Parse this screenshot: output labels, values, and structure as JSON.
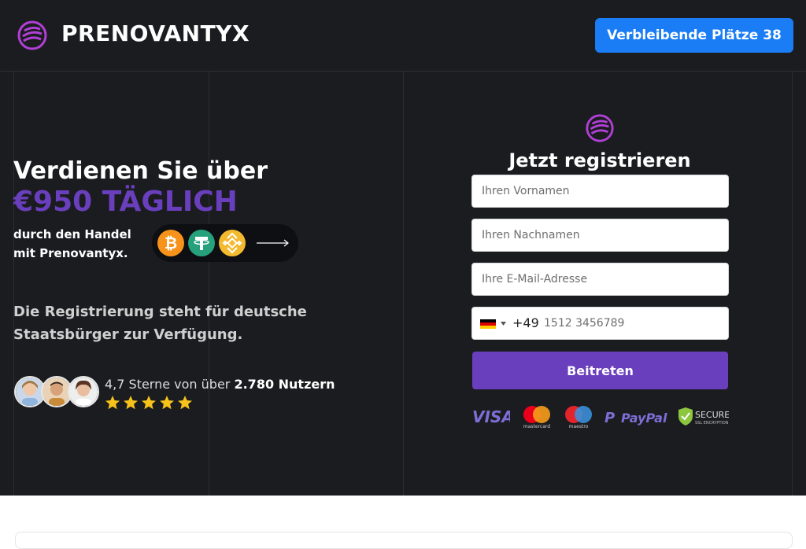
{
  "header": {
    "brand": "PRENOVANTYX",
    "cta_label": "Verbleibende Plätze 38"
  },
  "hero": {
    "headline": "Verdienen Sie über",
    "amount": "€950 TÄGLICH",
    "subtext": "durch den Handel mit Prenovantyx.",
    "coins": [
      "bitcoin-icon",
      "tether-icon",
      "binance-icon"
    ],
    "availability": "Die Registrierung steht für deutsche Staatsbürger zur Verfügung.",
    "rating": {
      "prefix": "4,7 Sterne von über",
      "count": "2.780 Nutzern",
      "stars": 5
    }
  },
  "form": {
    "title": "Jetzt registrieren",
    "first_name_placeholder": "Ihren Vornamen",
    "last_name_placeholder": "Ihren Nachnamen",
    "email_placeholder": "Ihre E-Mail-Adresse",
    "phone": {
      "country_flag": "germany-flag-icon",
      "dial_code": "+49",
      "placeholder": "1512 3456789"
    },
    "submit_label": "Beitreten"
  },
  "payment_badges": {
    "visa": "VISA",
    "mastercard": "mastercard",
    "maestro": "maestro",
    "paypal": "PayPal",
    "secure": "SECURE",
    "secure_sub": "SSL ENCRYPTION"
  },
  "colors": {
    "background": "#1a1c20",
    "accent_purple": "#6a3fbd",
    "cta_blue": "#1a7df5"
  }
}
